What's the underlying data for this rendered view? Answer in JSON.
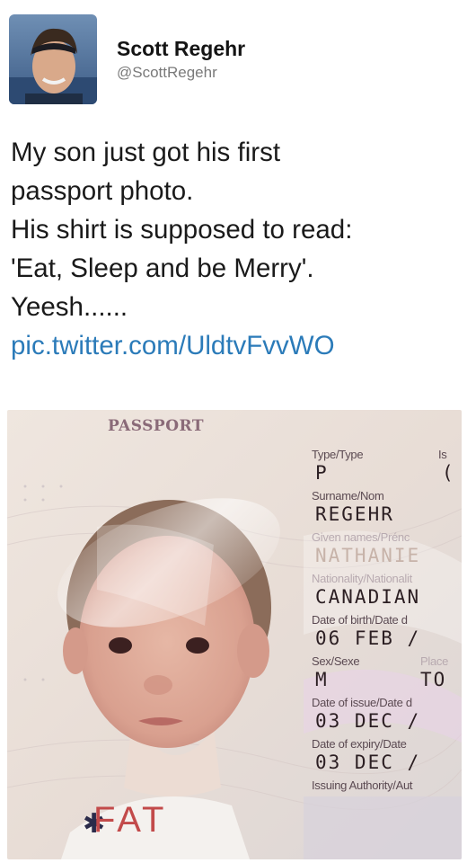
{
  "tweet": {
    "author": {
      "name": "Scott Regehr",
      "handle": "@ScottRegehr"
    },
    "text_lines": [
      "My son just got his first",
      "passport photo.",
      "His shirt is supposed to read:",
      "'Eat, Sleep and be Merry'.",
      "Yeesh......"
    ],
    "link": "pic.twitter.com/UldtvFvvWO"
  },
  "passport": {
    "title": "PASSPORT",
    "type_label": "Type/Type",
    "type_value": "P",
    "issuing_country_label": "Is",
    "issuing_country_value": "(",
    "surname_label": "Surname/Nom",
    "surname_value": "REGEHR",
    "given_names_label": "Given names/Prénc",
    "given_names_value": "NATHANIE",
    "nationality_label": "Nationality/Nationalit",
    "nationality_value": "CANADIAN",
    "dob_label": "Date of birth/Date d",
    "dob_value": "06 FEB /",
    "sex_label": "Sex/Sexe",
    "place_label": "Place",
    "sex_value": "M",
    "place_value": "TO",
    "issue_label": "Date of issue/Date d",
    "issue_value": "03 DEC /",
    "expiry_label": "Date of expiry/Date",
    "expiry_value": "03 DEC /",
    "authority_label": "Issuing Authority/Aut",
    "shirt_text": "FAT"
  }
}
